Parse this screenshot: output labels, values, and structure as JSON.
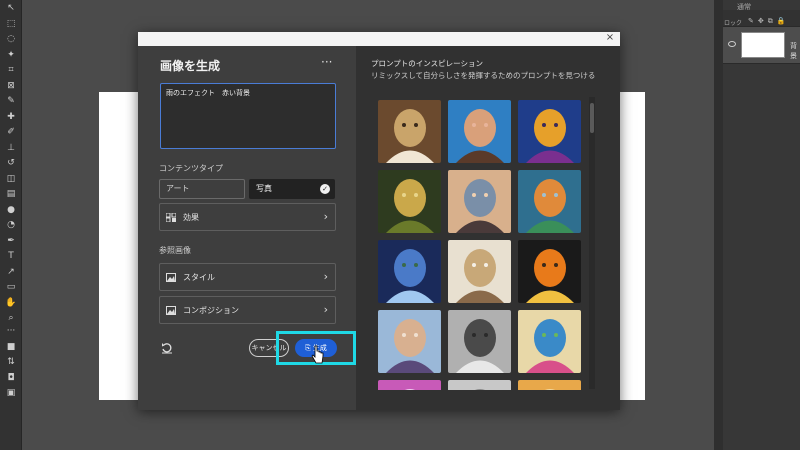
{
  "dialog": {
    "title": "画像を生成",
    "more_label": "···",
    "close_label": "×",
    "prompt_value": "雨のエフェクト　赤い背景",
    "content_type_label": "コンテンツタイプ",
    "content_type_options": [
      "アート",
      "写真"
    ],
    "selected_content_type": "写真",
    "effects_label": "効果",
    "reference_label": "参照画像",
    "style_label": "スタイル",
    "composition_label": "コンポジション",
    "cancel_label": "キャンセル",
    "generate_label": "生成"
  },
  "inspiration": {
    "title": "プロンプトのインスピレーション",
    "subtitle": "リミックスして自分らしさを発揮するためのプロンプトを見つける",
    "tiles": [
      {
        "icon": "portrait-elderly-man"
      },
      {
        "icon": "portrait-woman-glasses"
      },
      {
        "icon": "portrait-colorful-woman"
      },
      {
        "icon": "golden-spiral"
      },
      {
        "icon": "beach-woman"
      },
      {
        "icon": "dragon"
      },
      {
        "icon": "floating-island"
      },
      {
        "icon": "kitchen-interior"
      },
      {
        "icon": "butterfly"
      },
      {
        "icon": "woman-hat"
      },
      {
        "icon": "man-sketch"
      },
      {
        "icon": "paisley-pattern"
      },
      {
        "icon": "partial-tile"
      },
      {
        "icon": "partial-tile"
      },
      {
        "icon": "partial-tile"
      }
    ]
  },
  "layers_panel": {
    "title": "通常",
    "lock_label": "ロック",
    "layer_name": "背景"
  },
  "colors": {
    "accent": "#1f5fd6",
    "highlight": "#1fd9e6"
  }
}
